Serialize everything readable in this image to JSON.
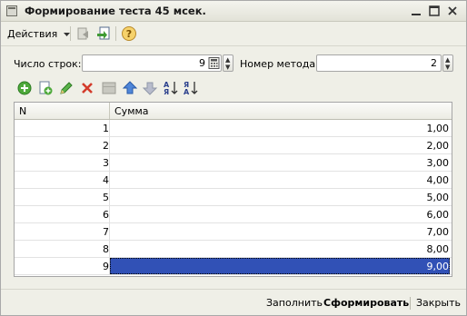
{
  "window": {
    "title": "Формирование теста 45 мсек."
  },
  "toolbar": {
    "actions_label": "Действия"
  },
  "form": {
    "rows_label": "Число строк:",
    "rows_value": "9",
    "method_label": "Номер метода:",
    "method_value": "2"
  },
  "table": {
    "columns": [
      "N",
      "Сумма"
    ],
    "rows": [
      {
        "n": "1",
        "sum": "1,00"
      },
      {
        "n": "2",
        "sum": "2,00"
      },
      {
        "n": "3",
        "sum": "3,00"
      },
      {
        "n": "4",
        "sum": "4,00"
      },
      {
        "n": "5",
        "sum": "5,00"
      },
      {
        "n": "6",
        "sum": "6,00"
      },
      {
        "n": "7",
        "sum": "7,00"
      },
      {
        "n": "8",
        "sum": "8,00"
      },
      {
        "n": "9",
        "sum": "9,00"
      }
    ],
    "selected_row": 9
  },
  "bottom": {
    "fill_label": "Заполнить",
    "generate_label": "Сформировать",
    "close_label": "Закрыть"
  },
  "colors": {
    "selection": "#3151b6",
    "window_bg": "#efefe7"
  }
}
